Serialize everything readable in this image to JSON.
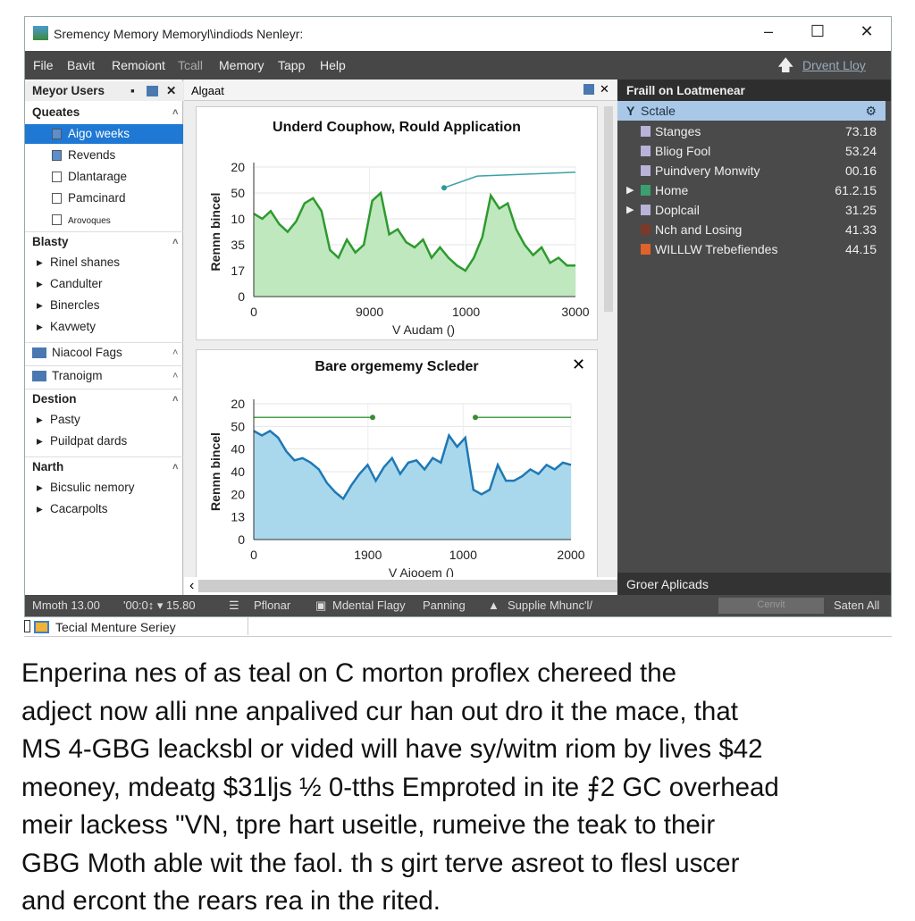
{
  "window": {
    "title": "Sremency Memory Memoryl\\indiods Nenleyr:",
    "minimize": "–",
    "maximize": "☐",
    "close": "✕"
  },
  "menu": [
    "File",
    "Bavit",
    "Remoiont",
    "Tcall",
    "Memory",
    "Tapp",
    "Help"
  ],
  "menu_right": {
    "up_icon": "arrow-up-icon",
    "link": "Drvent Lloy"
  },
  "left_panel": {
    "title": "Meyor Users",
    "sections": [
      {
        "label": "Queates",
        "items": [
          "Aigo weeks",
          "Revends",
          "Dlantarage",
          "Pamcinard",
          "Arovoques"
        ]
      },
      {
        "label": "Blasty",
        "items": [
          "Rinel shanes",
          "Candulter",
          "Binercles",
          "Kavwety"
        ]
      },
      {
        "label": "Niacool Fags"
      },
      {
        "label": "Tranoigm"
      },
      {
        "label": "Destion",
        "items": [
          "Pasty",
          "Puildpat dards"
        ]
      },
      {
        "label": "Narth",
        "items": [
          "Bicsulic nemory",
          "Cacarpolts"
        ]
      }
    ]
  },
  "center": {
    "tab": "Algaat"
  },
  "chart_data": [
    {
      "type": "area",
      "title": "Underd Couphow, Rould Application",
      "xlabel": "V Audam ()",
      "ylabel": "Rennn bincel",
      "y_ticks": [
        "0",
        "17",
        "35",
        "10",
        "50",
        "20"
      ],
      "x_ticks": [
        "0",
        "9000",
        "1000",
        "3000"
      ],
      "color": "#2e9a2e",
      "fill": "#bfe8bf",
      "values": [
        3.2,
        3.0,
        3.3,
        2.8,
        2.5,
        2.9,
        3.6,
        3.8,
        3.3,
        1.8,
        1.5,
        2.2,
        1.7,
        2.0,
        3.7,
        4.0,
        2.4,
        2.6,
        2.1,
        1.9,
        2.2,
        1.5,
        1.9,
        1.5,
        1.2,
        1.0,
        1.5,
        2.3,
        3.9,
        3.4,
        3.6,
        2.6,
        2.0,
        1.6,
        1.9,
        1.3,
        1.5,
        1.2,
        1.2
      ],
      "annotation": [
        [
          2.3,
          4.2
        ],
        [
          3.1,
          4.8
        ]
      ]
    },
    {
      "type": "area",
      "title": "Bare orgememy Scleder",
      "xlabel": "V Aiooem ()",
      "ylabel": "Rennn bincel",
      "y_ticks": [
        "0",
        "13",
        "20",
        "40",
        "40",
        "50",
        "20"
      ],
      "x_ticks": [
        "0",
        "1900",
        "1000",
        "2000"
      ],
      "color": "#1f78b4",
      "fill": "#a9d8ec",
      "values": [
        4.8,
        4.6,
        4.8,
        4.5,
        3.9,
        3.5,
        3.6,
        3.4,
        3.1,
        2.5,
        2.1,
        1.8,
        2.4,
        2.9,
        3.3,
        2.6,
        3.2,
        3.6,
        2.9,
        3.4,
        3.5,
        3.1,
        3.6,
        3.4,
        4.6,
        4.1,
        4.5,
        2.2,
        2.0,
        2.2,
        3.3,
        2.6,
        2.6,
        2.8,
        3.1,
        2.9,
        3.3,
        3.1,
        3.4,
        3.3
      ],
      "annotation": [
        [
          0,
          5.0
        ],
        [
          1.6,
          5.0
        ],
        [
          4.6,
          5.0
        ],
        [
          6.3,
          5.0
        ]
      ],
      "close": "✕"
    }
  ],
  "right_panel": {
    "title": "Fraill on Loatmenear",
    "header": "Sctale",
    "items": [
      {
        "name": "Stanges",
        "value": "73.18"
      },
      {
        "name": "Bliog Fool",
        "value": "53.24"
      },
      {
        "name": "Puindvery Monwity",
        "value": "00.16"
      },
      {
        "name": "Home",
        "value": "61.2.15"
      },
      {
        "name": "Doplcail",
        "value": "31.25"
      },
      {
        "name": "Nch and Losing",
        "value": "41.33"
      },
      {
        "name": "WILLLW Trebefiendes",
        "value": "44.15"
      }
    ],
    "footer": "Groer Aplicads"
  },
  "status": {
    "a": "Mmoth 13.00",
    "b": "'00:0↕ ▾  15.80",
    "c": "Pflonar",
    "d": "Mdental Flagy",
    "e": "Panning",
    "f": "Supplie Mhunc'l/",
    "g": "Cenvit",
    "h": "Saten All"
  },
  "taskbar": {
    "item": "Tecial Menture Seriey"
  },
  "paragraph": [
    "Enperina nes of as teal on C morton proflex chereed the",
    "adject now alli nne anpalived cur han out dro it the mace, that",
    "MS 4-GBG leacksbl or vided will have sy/witm riom by lives $42",
    "meoney, mdeatg $31ljs ½ 0-tths Emproted in ite ⨎2 GC overhead",
    "meir lackess \"VN, tpre hart useitle, rumeive the teak to their",
    "GBG Moth able wit the faol. th s girt terve asreot to flesl uscer",
    "and ercont the rears rea in the rited."
  ]
}
